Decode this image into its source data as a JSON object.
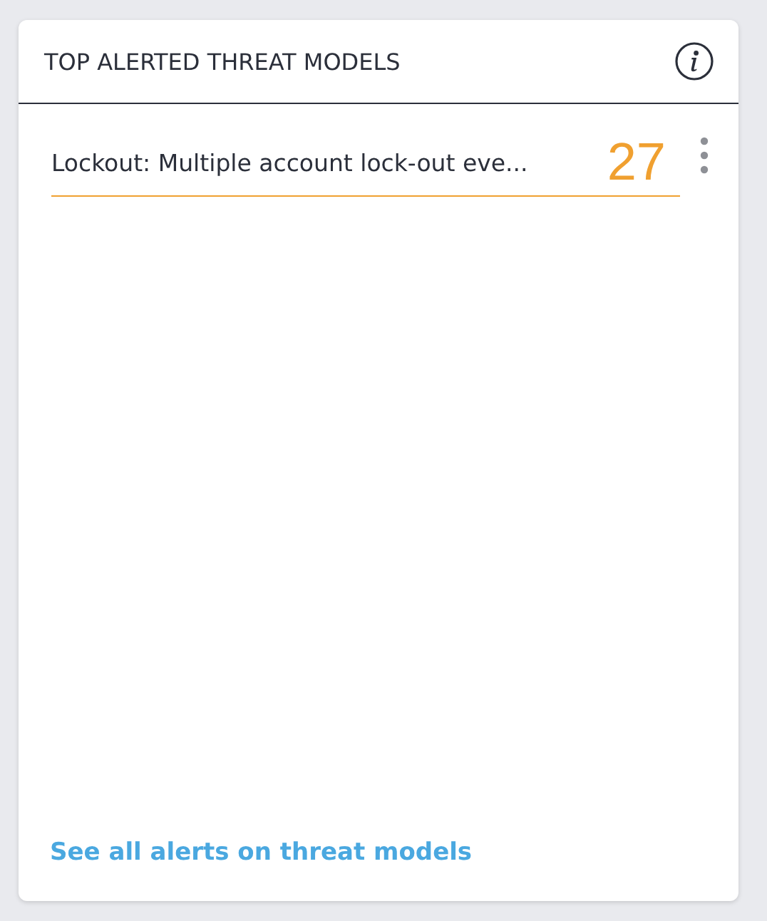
{
  "card": {
    "title": "TOP ALERTED THREAT MODELS"
  },
  "items": [
    {
      "name": "Lockout: Multiple account lock-out eve...",
      "count": "27"
    }
  ],
  "footer_link": "See all alerts on threat models"
}
